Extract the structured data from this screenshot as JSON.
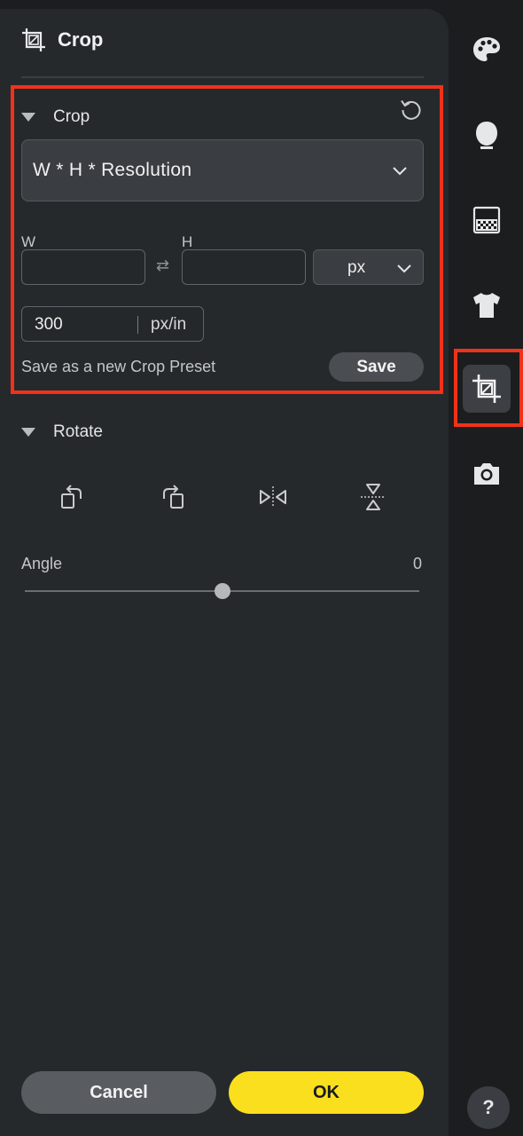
{
  "header": {
    "title": "Crop",
    "icon": "crop-icon"
  },
  "crop_section": {
    "title": "Crop",
    "reset_icon": "reset-icon",
    "mode_select": {
      "value": "W * H * Resolution",
      "icon": "chevron-down-icon"
    },
    "width": {
      "label": "W",
      "value": ""
    },
    "height": {
      "label": "H",
      "value": ""
    },
    "swap_icon": "swap-arrows-icon",
    "unit_select": {
      "value": "px",
      "icon": "chevron-down-icon"
    },
    "resolution": {
      "value": "300",
      "unit": "px/in"
    },
    "save_preset_text": "Save as a new Crop Preset",
    "save_button": "Save"
  },
  "rotate_section": {
    "title": "Rotate",
    "actions": [
      "rotate-left-icon",
      "rotate-right-icon",
      "flip-horizontal-icon",
      "flip-vertical-icon"
    ],
    "angle": {
      "label": "Angle",
      "value": "0",
      "slider_fraction": 0.5
    }
  },
  "footer": {
    "cancel": "Cancel",
    "ok": "OK"
  },
  "rail": {
    "items": [
      "palette-icon",
      "face-icon",
      "background-icon",
      "clothing-icon",
      "crop-icon",
      "camera-icon"
    ],
    "active": "crop-icon",
    "help": "?"
  },
  "colors": {
    "accent_ok": "#fadf1e",
    "highlight": "#f0321a",
    "panel": "#26292c",
    "background": "#1c1d1f"
  }
}
